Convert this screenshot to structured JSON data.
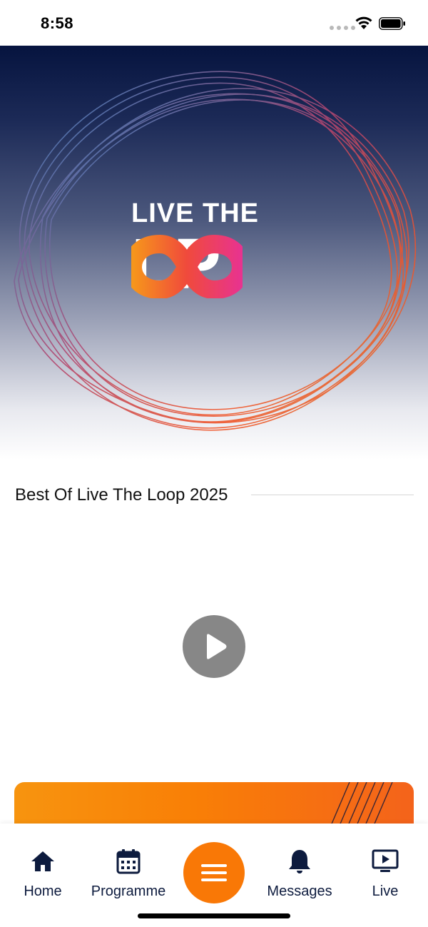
{
  "status_bar": {
    "time": "8:58"
  },
  "hero": {
    "logo_line1": "LIVE THE",
    "logo_letter_l": "L",
    "logo_letter_p": "P"
  },
  "section": {
    "title": "Best Of Live The Loop 2025"
  },
  "tab_bar": {
    "items": [
      {
        "label": "Home",
        "icon": "home-icon"
      },
      {
        "label": "Programme",
        "icon": "calendar-icon"
      },
      {
        "label": "Messages",
        "icon": "bell-icon"
      },
      {
        "label": "Live",
        "icon": "play-screen-icon"
      }
    ],
    "menu_icon": "hamburger-menu-icon"
  },
  "colors": {
    "navy": "#0d1b3e",
    "accent_orange": "#f97806",
    "play_grey": "#878787"
  }
}
